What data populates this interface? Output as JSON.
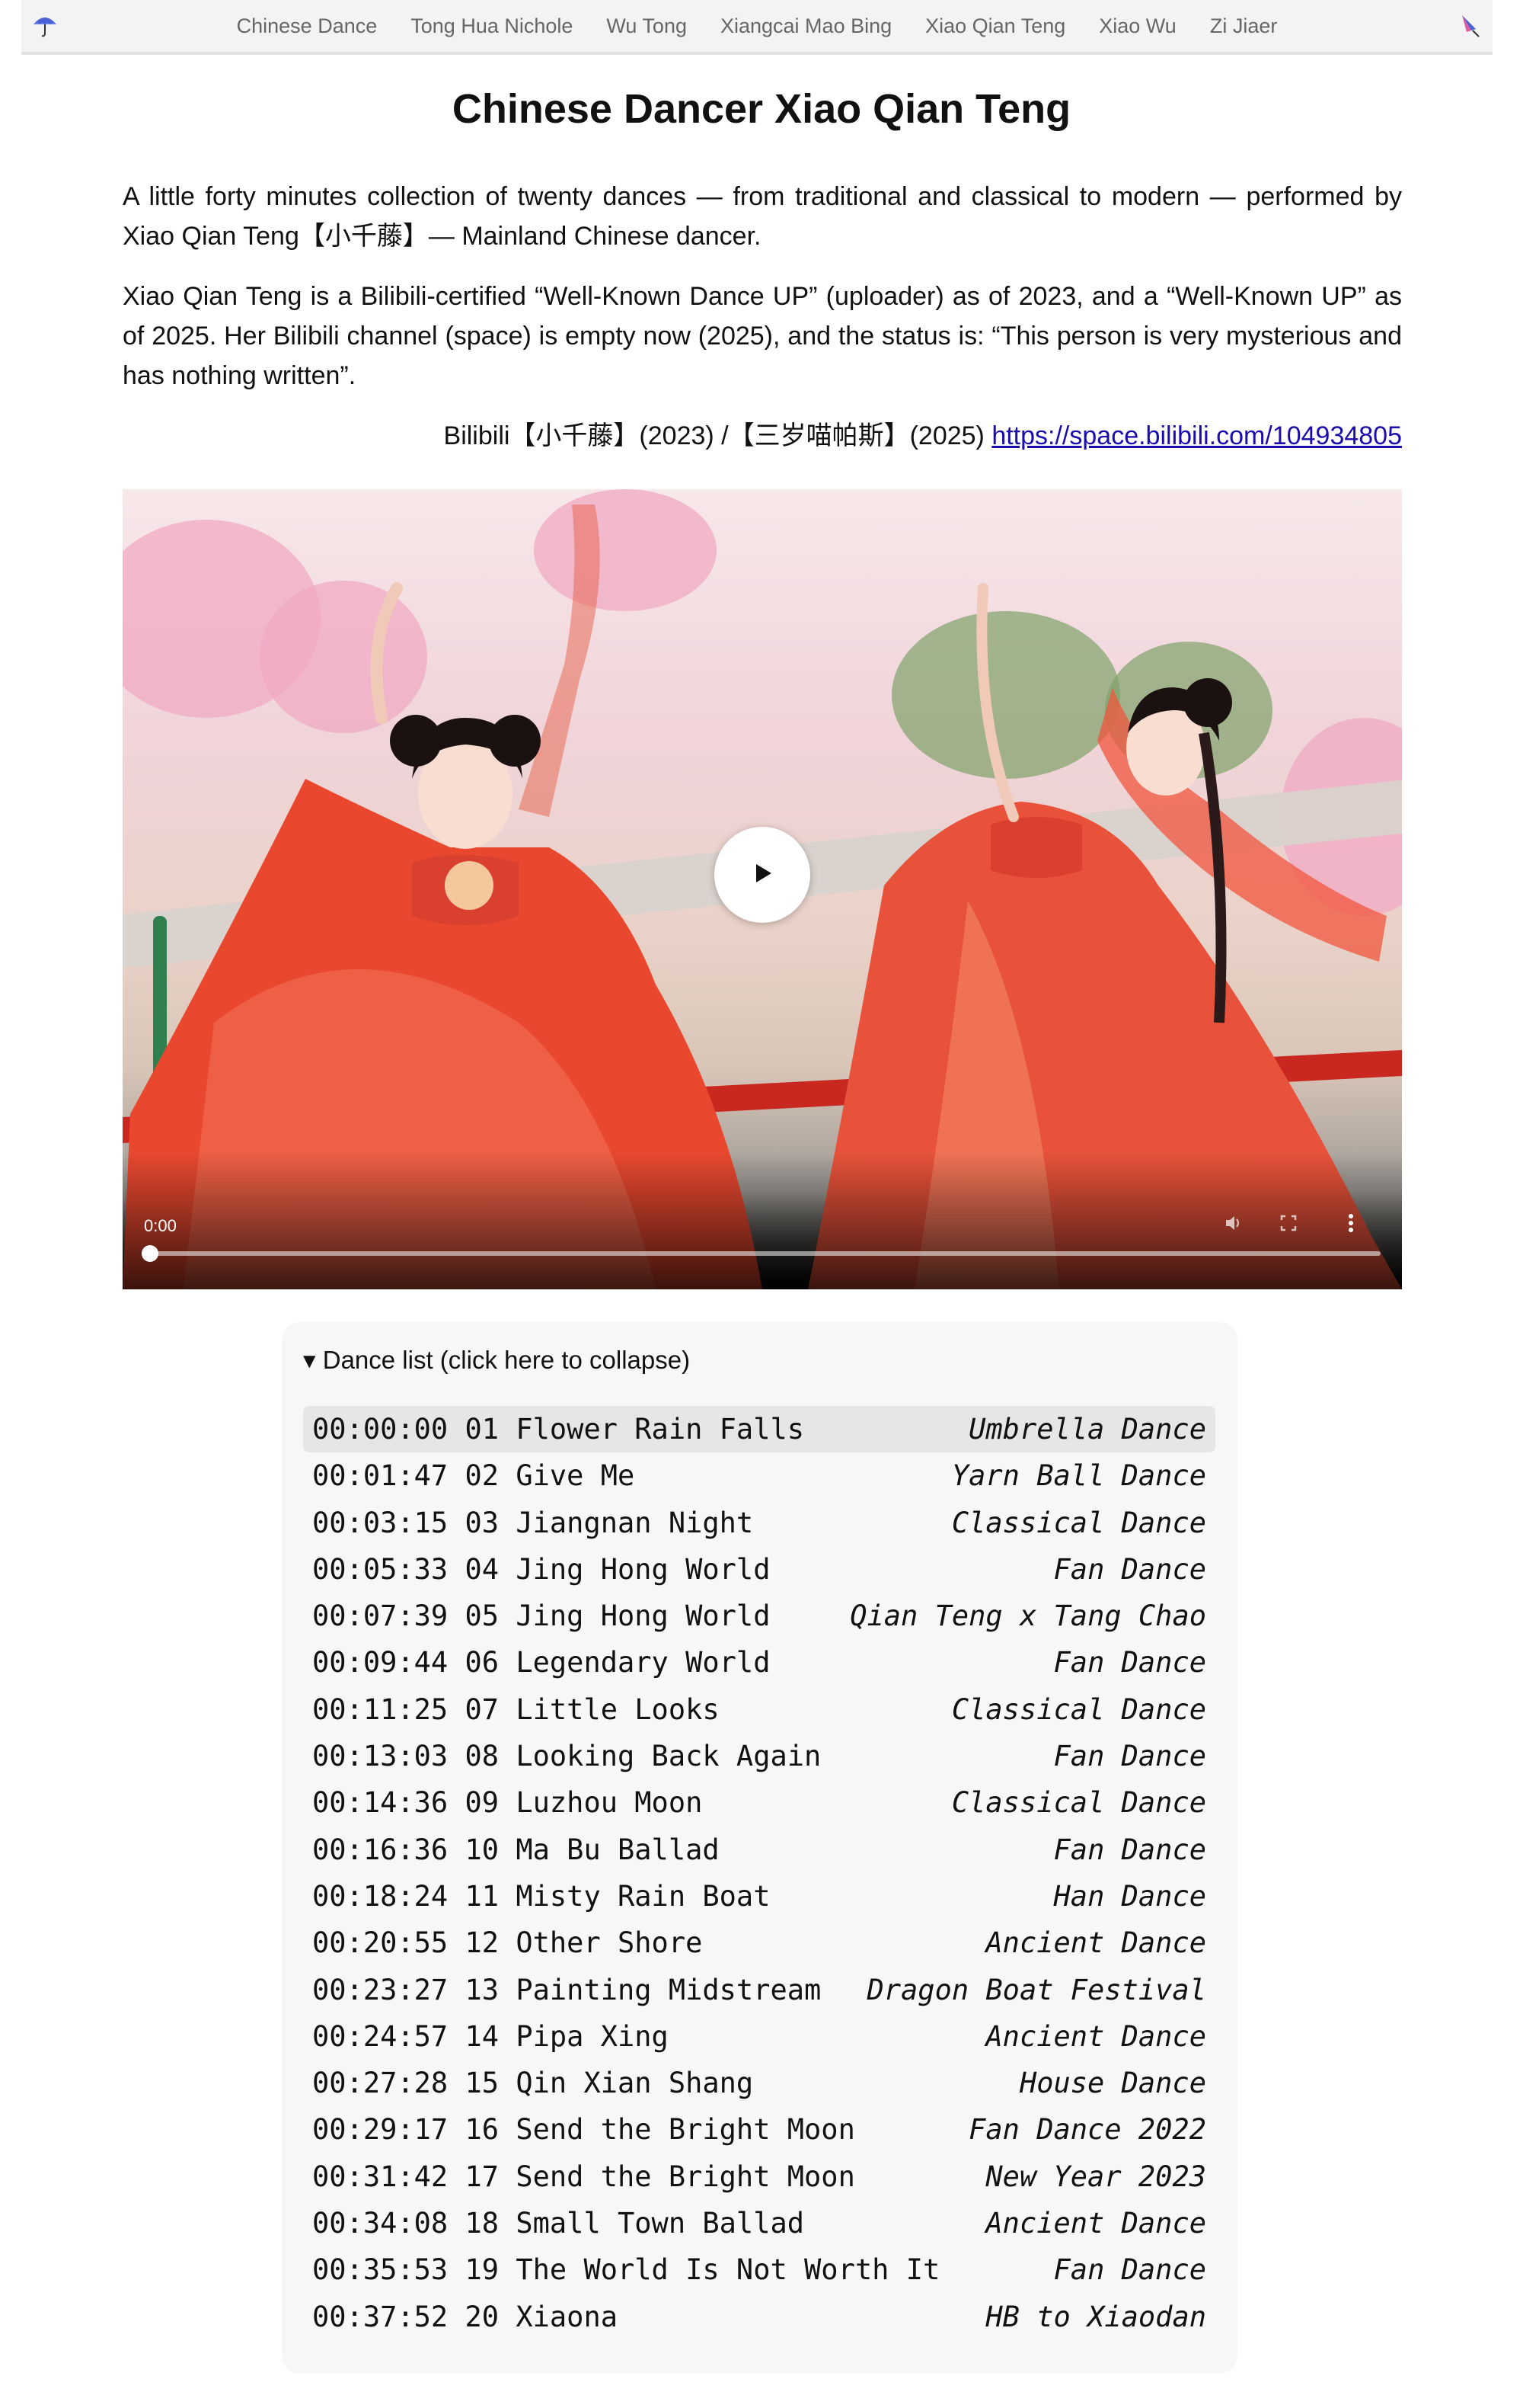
{
  "nav": {
    "items": [
      "Chinese Dance",
      "Tong Hua Nichole",
      "Wu Tong",
      "Xiangcai Mao Bing",
      "Xiao Qian Teng",
      "Xiao Wu",
      "Zi Jiaer"
    ],
    "left_icon": "umbrella-icon",
    "right_icon": "closed-umbrella-icon"
  },
  "page": {
    "title": "Chinese Dancer Xiao Qian Teng",
    "intro": "A little forty minutes collection of twenty dances — from traditional and classical to modern — performed by Xiao Qian Teng【小千藤】— Mainland Chinese dancer.",
    "status": "Xiao Qian Teng is a Bilibili-certified “Well-Known Dance UP” (uploader) as of 2023, and a “Well-Known UP” as of 2025. Her Bilibili channel (space) is empty now (2025), and the status is: “This person is very mysterious and has nothing written”.",
    "source_text": "Bilibili【小千藤】(2023) /【三岁喵帕斯】(2025) ",
    "source_link": "https://space.bilibili.com/104934805"
  },
  "video": {
    "time": "0:00",
    "progress": 0,
    "play_icon": "play-icon",
    "mute_icon": "volume-icon",
    "fullscreen_icon": "fullscreen-icon",
    "menu_icon": "more-vertical-icon"
  },
  "dance_list": {
    "summary": "▾ Dance list (click here to collapse)",
    "items": [
      {
        "time": "00:00:00",
        "num": "01",
        "title": "Flower Rain Falls",
        "category": "Umbrella Dance"
      },
      {
        "time": "00:01:47",
        "num": "02",
        "title": "Give Me",
        "category": "Yarn Ball Dance"
      },
      {
        "time": "00:03:15",
        "num": "03",
        "title": "Jiangnan Night",
        "category": "Classical Dance"
      },
      {
        "time": "00:05:33",
        "num": "04",
        "title": "Jing Hong World",
        "category": "Fan Dance"
      },
      {
        "time": "00:07:39",
        "num": "05",
        "title": "Jing Hong World",
        "category": "Qian Teng x Tang Chao"
      },
      {
        "time": "00:09:44",
        "num": "06",
        "title": "Legendary World",
        "category": "Fan Dance"
      },
      {
        "time": "00:11:25",
        "num": "07",
        "title": "Little Looks",
        "category": "Classical Dance"
      },
      {
        "time": "00:13:03",
        "num": "08",
        "title": "Looking Back Again",
        "category": "Fan Dance"
      },
      {
        "time": "00:14:36",
        "num": "09",
        "title": "Luzhou Moon",
        "category": "Classical Dance"
      },
      {
        "time": "00:16:36",
        "num": "10",
        "title": "Ma Bu Ballad",
        "category": "Fan Dance"
      },
      {
        "time": "00:18:24",
        "num": "11",
        "title": "Misty Rain Boat",
        "category": "Han Dance"
      },
      {
        "time": "00:20:55",
        "num": "12",
        "title": "Other Shore",
        "category": "Ancient Dance"
      },
      {
        "time": "00:23:27",
        "num": "13",
        "title": "Painting Midstream",
        "category": "Dragon Boat Festival"
      },
      {
        "time": "00:24:57",
        "num": "14",
        "title": "Pipa Xing",
        "category": "Ancient Dance"
      },
      {
        "time": "00:27:28",
        "num": "15",
        "title": "Qin Xian Shang",
        "category": "House Dance"
      },
      {
        "time": "00:29:17",
        "num": "16",
        "title": "Send the Bright Moon",
        "category": "Fan Dance 2022"
      },
      {
        "time": "00:31:42",
        "num": "17",
        "title": "Send the Bright Moon",
        "category": "New Year 2023"
      },
      {
        "time": "00:34:08",
        "num": "18",
        "title": "Small Town Ballad",
        "category": "Ancient Dance"
      },
      {
        "time": "00:35:53",
        "num": "19",
        "title": "The World Is Not Worth It",
        "category": "Fan Dance"
      },
      {
        "time": "00:37:52",
        "num": "20",
        "title": "Xiaona",
        "category": "HB to Xiaodan"
      }
    ],
    "active_index": 0
  },
  "colors": {
    "nav_bg": "#f3f3f3",
    "nav_text": "#666666",
    "link": "#1a0dab",
    "list_bg": "#f7f7f7",
    "active_row": "#e6e6e6",
    "costume_red": "#e9482f",
    "umbrella_blue": "#4a63d6",
    "umbrella_pink": "#e05aa0"
  }
}
